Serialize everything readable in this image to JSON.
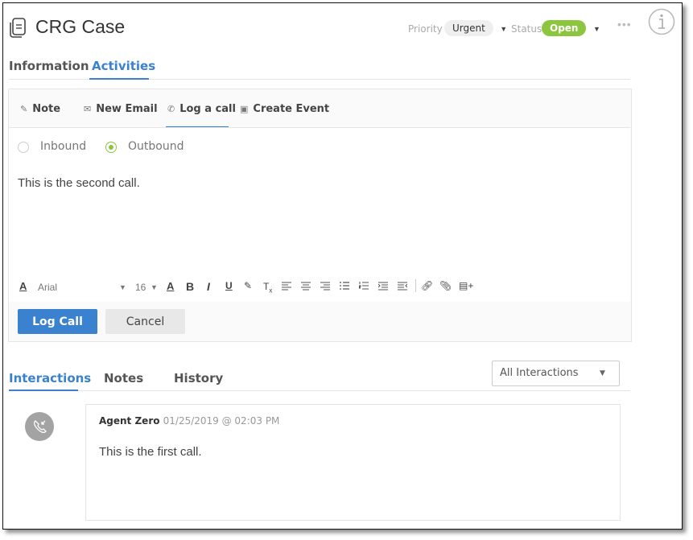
{
  "header": {
    "title": "CRG Case",
    "title_icon": "document-icon",
    "priority_label": "Priority",
    "priority_value": "Urgent",
    "status_label": "Status",
    "status_value": "Open",
    "status_color": "#8cc63f",
    "more_icon": "ellipsis-icon",
    "info_icon": "info-icon"
  },
  "top_tabs": [
    {
      "label": "Information",
      "active": false
    },
    {
      "label": "Activities",
      "active": true
    }
  ],
  "composer": {
    "tabs": [
      {
        "label": "Note",
        "icon": "pencil-icon",
        "glyph": "✎",
        "active": false
      },
      {
        "label": "New Email",
        "icon": "envelope-icon",
        "glyph": "✉",
        "active": false
      },
      {
        "label": "Log a call",
        "icon": "phone-icon",
        "glyph": "✆",
        "active": true
      },
      {
        "label": "Create Event",
        "icon": "calendar-icon",
        "glyph": "▣",
        "active": false
      }
    ],
    "direction_options": [
      {
        "label": "Inbound",
        "selected": false
      },
      {
        "label": "Outbound",
        "selected": true
      }
    ],
    "editor_text": "This is the second call.",
    "toolbar": {
      "font_family": "Arial",
      "font_size": "16"
    },
    "submit_label": "Log Call",
    "cancel_label": "Cancel"
  },
  "bottom_tabs": [
    {
      "label": "Interactions",
      "active": true
    },
    {
      "label": "Notes",
      "active": false
    },
    {
      "label": "History",
      "active": false
    }
  ],
  "filter": {
    "selected": "All Interactions"
  },
  "interactions": [
    {
      "type_icon": "incoming-call-icon",
      "author": "Agent Zero",
      "timestamp": "01/25/2019 @ 02:03 PM",
      "body": "This is the first call."
    }
  ],
  "accent_color": "#3a82cf"
}
